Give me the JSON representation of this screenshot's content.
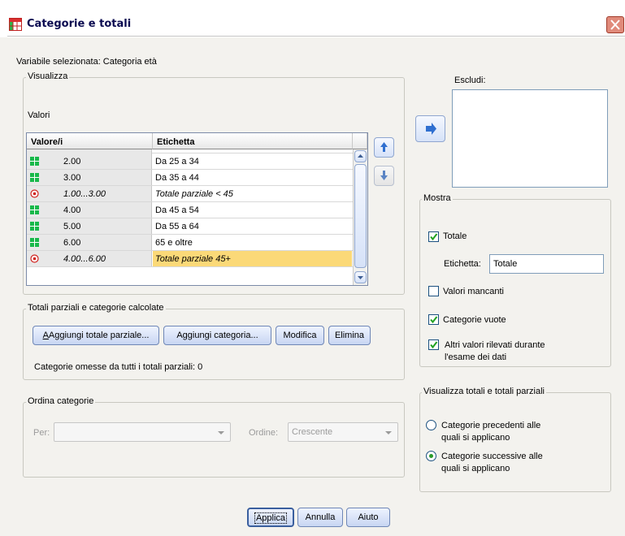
{
  "window": {
    "title": "Categorie e totali"
  },
  "selected_variable": "Variabile selezionata: Categoria età",
  "visualizza": {
    "legend": "Visualizza",
    "values_label": "Valori",
    "columns": [
      "Valore/i",
      "Etichetta"
    ],
    "rows": [
      {
        "value": "2.00",
        "label": "Da 25 a 34",
        "kind": "category",
        "selected": false
      },
      {
        "value": "3.00",
        "label": "Da 35 a 44",
        "kind": "category",
        "selected": false
      },
      {
        "value": "1.00...3.00",
        "label": "Totale parziale < 45",
        "kind": "subtotal",
        "selected": false
      },
      {
        "value": "4.00",
        "label": "Da 45 a 54",
        "kind": "category",
        "selected": false
      },
      {
        "value": "5.00",
        "label": "Da 55 a 64",
        "kind": "category",
        "selected": false
      },
      {
        "value": "6.00",
        "label": "65 e oltre",
        "kind": "category",
        "selected": false
      },
      {
        "value": "4.00...6.00",
        "label": "Totale parziale 45+",
        "kind": "subtotal",
        "selected": true
      }
    ]
  },
  "totali": {
    "legend": "Totali parziali e categorie calcolate",
    "buttons": [
      "Aggiungi totale parziale...",
      "Aggiungi categoria...",
      "Modifica",
      "Elimina"
    ],
    "omitted_text": "Categorie omesse da tutti i totali parziali: 0"
  },
  "ordina": {
    "legend": "Ordina categorie",
    "per_label": "Per:",
    "per_value": "",
    "ordine_label": "Ordine:",
    "ordine_value": "Crescente"
  },
  "escludi": {
    "label": "Escludi:"
  },
  "mostra": {
    "legend": "Mostra",
    "totale_label": "Totale",
    "totale_checked": true,
    "etichetta_label": "Etichetta:",
    "etichetta_value": "Totale",
    "valori_mancanti_label": "Valori mancanti",
    "valori_mancanti_checked": false,
    "categorie_vuote_label": "Categorie vuote",
    "categorie_vuote_checked": true,
    "altri_valori_line1": "Altri valori rilevati durante",
    "altri_valori_line2": "l'esame dei dati",
    "altri_valori_checked": true
  },
  "visualizza_totali": {
    "legend": "Visualizza totali e totali parziali",
    "option1_line1": "Categorie precedenti alle",
    "option1_line2": "quali si applicano",
    "option2_line1": "Categorie successive alle",
    "option2_line2": "quali si applicano",
    "selected": 2
  },
  "footer": {
    "applica": "Applica",
    "annulla": "Annulla",
    "aiuto": "Aiuto"
  },
  "colors": {
    "selected_row": "#fbd978",
    "category_icon": "#18b84a",
    "subtotal_icon": "#d0221f"
  }
}
